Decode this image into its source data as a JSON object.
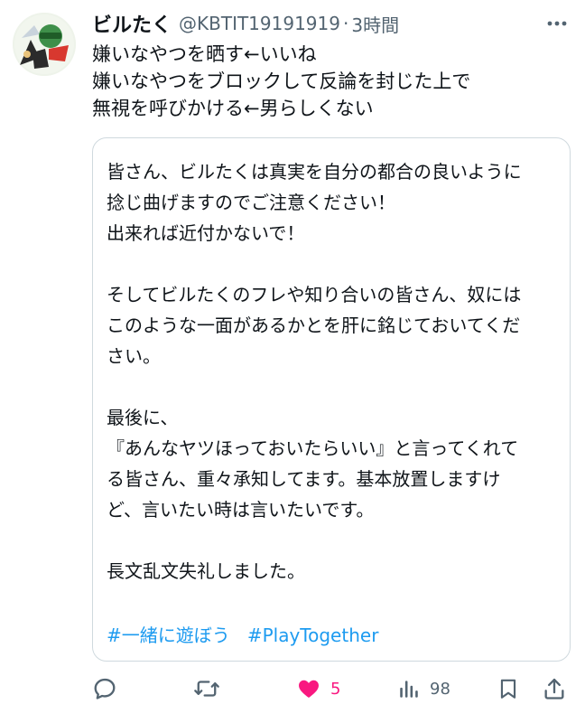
{
  "tweet": {
    "display_name": "ビルたく",
    "handle": "@KBTIT19191919",
    "separator": "·",
    "time": "3時間",
    "lines": [
      "嫌いなやつを晒す←いいね",
      "嫌いなやつをブロックして反論を封じた上で",
      "無視を呼びかける←男らしくない"
    ]
  },
  "quote": {
    "lines": [
      "皆さん、ビルたくは真実を自分の都合の良いように",
      "捻じ曲げますのでご注意ください！",
      "出来れば近付かないで！",
      "",
      "そしてビルたくのフレや知り合いの皆さん、奴には",
      "このような一面があるかとを肝に銘じておいてくだ",
      "さい。",
      "",
      "最後に、",
      "『あんなヤツほっておいたらいい』と言ってくれて",
      "る皆さん、重々承知してます。基本放置しますけ",
      "ど、言いたい時は言いたいです。",
      "",
      "長文乱文失礼しました。"
    ],
    "hashtags": [
      "#一緒に遊ぼう",
      "#PlayTogether"
    ]
  },
  "actions": {
    "reply_count": "",
    "retweet_count": "",
    "like_count": "5",
    "views_count": "98"
  },
  "colors": {
    "text": "#0f1419",
    "secondary": "#536471",
    "link": "#1d9bf0",
    "like": "#f91880",
    "border": "#cfd9de"
  }
}
